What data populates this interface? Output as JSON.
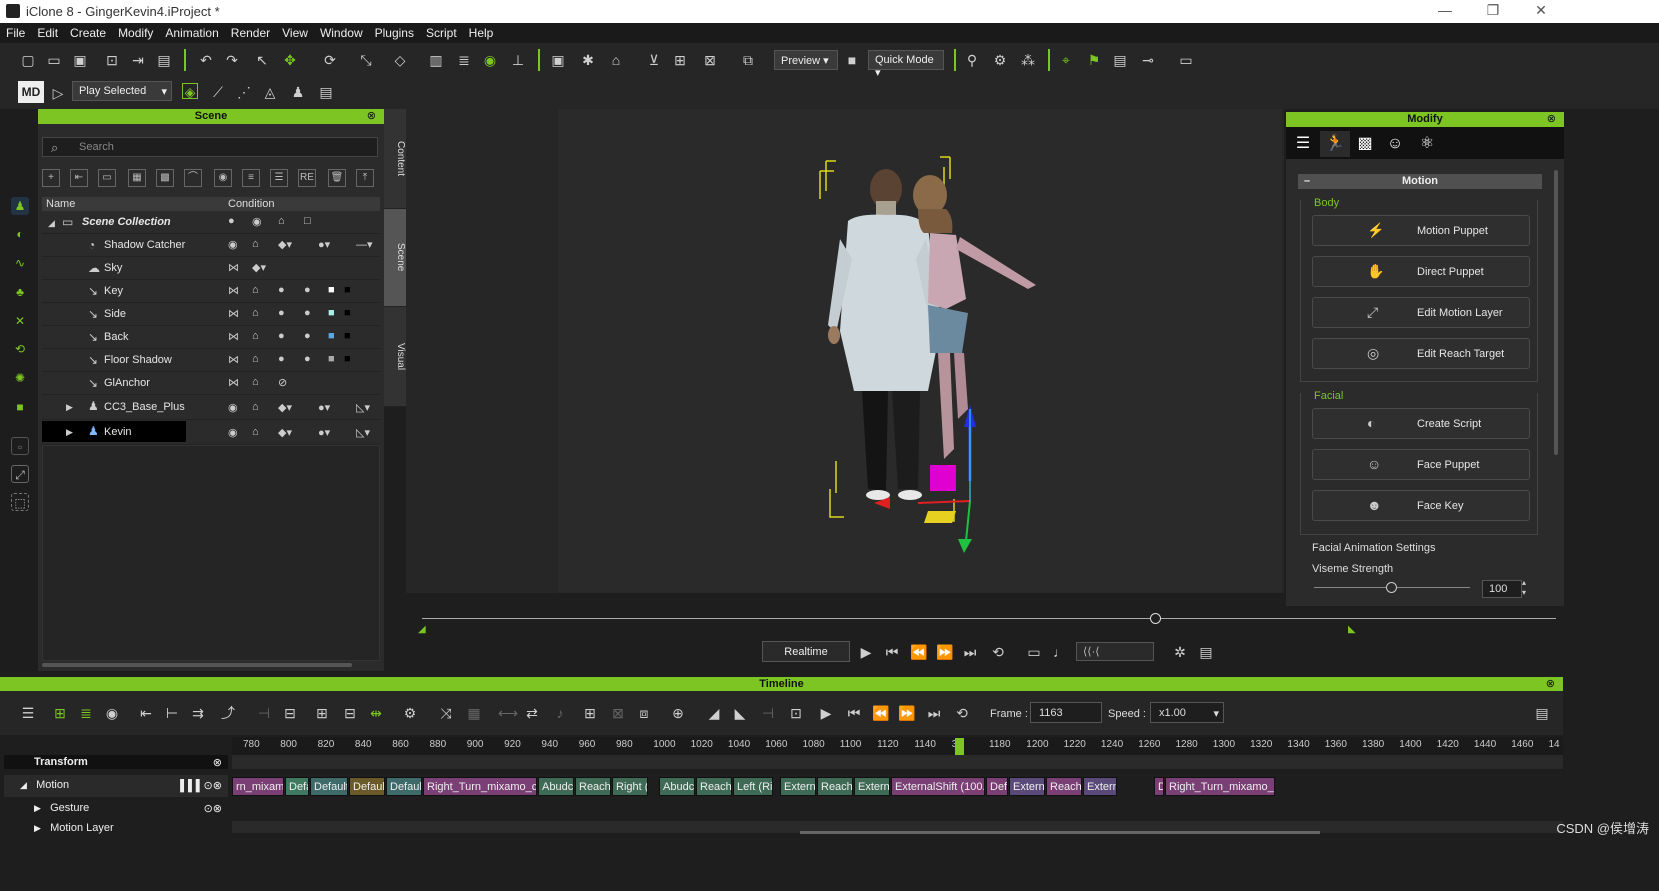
{
  "window": {
    "title": "iClone 8 - GingerKevin4.iProject *",
    "minimize": "—",
    "restore": "❐",
    "close": "✕"
  },
  "menu": [
    "File",
    "Edit",
    "Create",
    "Modify",
    "Animation",
    "Render",
    "View",
    "Window",
    "Plugins",
    "Script",
    "Help"
  ],
  "toolbar": {
    "preview_label": "Preview",
    "quickmode_label": "Quick Mode",
    "play_selected_label": "Play Selected"
  },
  "scene": {
    "title": "Scene",
    "search_placeholder": "Search",
    "col_name": "Name",
    "col_condition": "Condition",
    "rows": [
      {
        "name": "Scene Collection"
      },
      {
        "name": "Shadow Catcher"
      },
      {
        "name": "Sky"
      },
      {
        "name": "Key"
      },
      {
        "name": "Side"
      },
      {
        "name": "Back"
      },
      {
        "name": "Floor Shadow"
      },
      {
        "name": "GlAnchor"
      },
      {
        "name": "CC3_Base_Plus"
      },
      {
        "name": "Kevin"
      }
    ],
    "side_tabs": [
      "Content",
      "Scene",
      "Visual"
    ]
  },
  "modify": {
    "title": "Modify",
    "section": "Motion",
    "body_label": "Body",
    "body_buttons": [
      "Motion Puppet",
      "Direct Puppet",
      "Edit Motion Layer",
      "Edit Reach Target"
    ],
    "facial_label": "Facial",
    "facial_buttons": [
      "Create Script",
      "Face Puppet",
      "Face Key"
    ],
    "facial_settings_label": "Facial Animation Settings",
    "viseme_label": "Viseme Strength",
    "viseme_value": "100",
    "viseme_fraction": 0.5
  },
  "playback": {
    "realtime_label": "Realtime"
  },
  "timeline": {
    "title": "Timeline",
    "frame_label": "Frame :",
    "frame_value": "1163",
    "speed_label": "Speed :",
    "speed_value": "x1.00",
    "ruler": [
      "780",
      "800",
      "820",
      "840",
      "860",
      "880",
      "900",
      "920",
      "940",
      "960",
      "980",
      "1000",
      "1020",
      "1040",
      "1060",
      "1080",
      "1100",
      "1120",
      "1140",
      "30",
      "1180",
      "1200",
      "1220",
      "1240",
      "1260",
      "1280",
      "1300",
      "1320",
      "1340",
      "1360",
      "1380",
      "1400",
      "1420",
      "1440",
      "1460",
      "14"
    ],
    "tracks": {
      "transform": "Transform",
      "motion": "Motion",
      "gesture": "Gesture",
      "motion_layer": "Motion Layer"
    },
    "clips": [
      {
        "label": "rn_mixamo_co",
        "color": "#7a3f74"
      },
      {
        "label": "Defa",
        "color": "#3f7a60"
      },
      {
        "label": "Default",
        "color": "#3f6a6a"
      },
      {
        "label": "Default",
        "color": "#6a5a2a"
      },
      {
        "label": "Default",
        "color": "#3f6a6a"
      },
      {
        "label": "Right_Turn_mixamo_con",
        "color": "#7a3f74"
      },
      {
        "label": "Abudct",
        "color": "#3f6a55"
      },
      {
        "label": "Reach",
        "color": "#3f6a55"
      },
      {
        "label": "Right (I",
        "color": "#3f6a55"
      },
      {
        "label": "Abudct",
        "color": "#3f6a55"
      },
      {
        "label": "Reach",
        "color": "#3f6a55"
      },
      {
        "label": "Left (Ri",
        "color": "#3f6a55"
      },
      {
        "label": "Externa",
        "color": "#3f6a55"
      },
      {
        "label": "Reach",
        "color": "#3f6a55"
      },
      {
        "label": "Externa",
        "color": "#3f6a55"
      },
      {
        "label": "ExternalShift (100.0(",
        "color": "#7a3f74"
      },
      {
        "label": "Def",
        "color": "#7a3f74"
      },
      {
        "label": "Externa",
        "color": "#5a4a7a"
      },
      {
        "label": "Reach",
        "color": "#7a3f74"
      },
      {
        "label": "Externa",
        "color": "#5a4a7a"
      },
      {
        "label": "D",
        "color": "#7a3f74"
      },
      {
        "label": "Right_Turn_mixamo_con",
        "color": "#7a3f74"
      }
    ]
  },
  "watermark": "CSDN @侯增涛"
}
